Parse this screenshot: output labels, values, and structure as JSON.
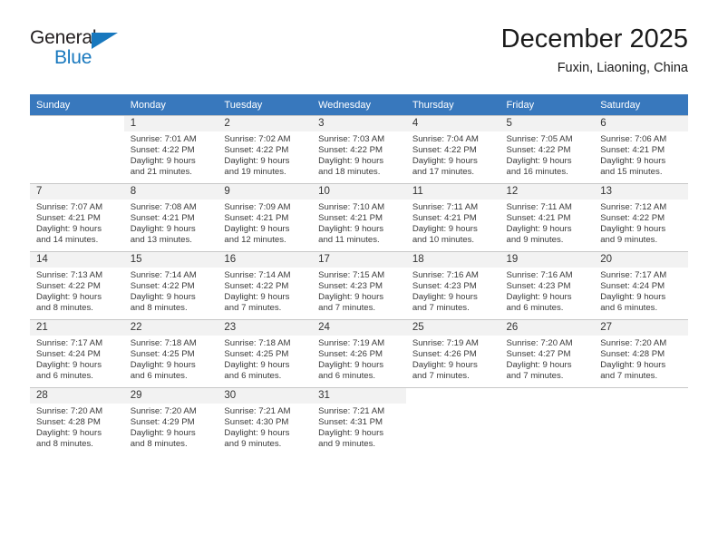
{
  "brand": {
    "name_part1": "General",
    "name_part2": "Blue",
    "triangle_color": "#1878be"
  },
  "header": {
    "title": "December 2025",
    "subtitle": "Fuxin, Liaoning, China",
    "header_bg": "#3878bd"
  },
  "weekdays": [
    "Sunday",
    "Monday",
    "Tuesday",
    "Wednesday",
    "Thursday",
    "Friday",
    "Saturday"
  ],
  "labels": {
    "sunrise_prefix": "Sunrise:",
    "sunset_prefix": "Sunset:",
    "daylight_prefix": "Daylight:"
  },
  "weeks": [
    [
      {
        "day": "",
        "empty": true
      },
      {
        "day": "1",
        "line1": "Sunrise: 7:01 AM",
        "line2": "Sunset: 4:22 PM",
        "line3": "Daylight: 9 hours",
        "line4": "and 21 minutes."
      },
      {
        "day": "2",
        "line1": "Sunrise: 7:02 AM",
        "line2": "Sunset: 4:22 PM",
        "line3": "Daylight: 9 hours",
        "line4": "and 19 minutes."
      },
      {
        "day": "3",
        "line1": "Sunrise: 7:03 AM",
        "line2": "Sunset: 4:22 PM",
        "line3": "Daylight: 9 hours",
        "line4": "and 18 minutes."
      },
      {
        "day": "4",
        "line1": "Sunrise: 7:04 AM",
        "line2": "Sunset: 4:22 PM",
        "line3": "Daylight: 9 hours",
        "line4": "and 17 minutes."
      },
      {
        "day": "5",
        "line1": "Sunrise: 7:05 AM",
        "line2": "Sunset: 4:22 PM",
        "line3": "Daylight: 9 hours",
        "line4": "and 16 minutes."
      },
      {
        "day": "6",
        "line1": "Sunrise: 7:06 AM",
        "line2": "Sunset: 4:21 PM",
        "line3": "Daylight: 9 hours",
        "line4": "and 15 minutes."
      }
    ],
    [
      {
        "day": "7",
        "line1": "Sunrise: 7:07 AM",
        "line2": "Sunset: 4:21 PM",
        "line3": "Daylight: 9 hours",
        "line4": "and 14 minutes."
      },
      {
        "day": "8",
        "line1": "Sunrise: 7:08 AM",
        "line2": "Sunset: 4:21 PM",
        "line3": "Daylight: 9 hours",
        "line4": "and 13 minutes."
      },
      {
        "day": "9",
        "line1": "Sunrise: 7:09 AM",
        "line2": "Sunset: 4:21 PM",
        "line3": "Daylight: 9 hours",
        "line4": "and 12 minutes."
      },
      {
        "day": "10",
        "line1": "Sunrise: 7:10 AM",
        "line2": "Sunset: 4:21 PM",
        "line3": "Daylight: 9 hours",
        "line4": "and 11 minutes."
      },
      {
        "day": "11",
        "line1": "Sunrise: 7:11 AM",
        "line2": "Sunset: 4:21 PM",
        "line3": "Daylight: 9 hours",
        "line4": "and 10 minutes."
      },
      {
        "day": "12",
        "line1": "Sunrise: 7:11 AM",
        "line2": "Sunset: 4:21 PM",
        "line3": "Daylight: 9 hours",
        "line4": "and 9 minutes."
      },
      {
        "day": "13",
        "line1": "Sunrise: 7:12 AM",
        "line2": "Sunset: 4:22 PM",
        "line3": "Daylight: 9 hours",
        "line4": "and 9 minutes."
      }
    ],
    [
      {
        "day": "14",
        "line1": "Sunrise: 7:13 AM",
        "line2": "Sunset: 4:22 PM",
        "line3": "Daylight: 9 hours",
        "line4": "and 8 minutes."
      },
      {
        "day": "15",
        "line1": "Sunrise: 7:14 AM",
        "line2": "Sunset: 4:22 PM",
        "line3": "Daylight: 9 hours",
        "line4": "and 8 minutes."
      },
      {
        "day": "16",
        "line1": "Sunrise: 7:14 AM",
        "line2": "Sunset: 4:22 PM",
        "line3": "Daylight: 9 hours",
        "line4": "and 7 minutes."
      },
      {
        "day": "17",
        "line1": "Sunrise: 7:15 AM",
        "line2": "Sunset: 4:23 PM",
        "line3": "Daylight: 9 hours",
        "line4": "and 7 minutes."
      },
      {
        "day": "18",
        "line1": "Sunrise: 7:16 AM",
        "line2": "Sunset: 4:23 PM",
        "line3": "Daylight: 9 hours",
        "line4": "and 7 minutes."
      },
      {
        "day": "19",
        "line1": "Sunrise: 7:16 AM",
        "line2": "Sunset: 4:23 PM",
        "line3": "Daylight: 9 hours",
        "line4": "and 6 minutes."
      },
      {
        "day": "20",
        "line1": "Sunrise: 7:17 AM",
        "line2": "Sunset: 4:24 PM",
        "line3": "Daylight: 9 hours",
        "line4": "and 6 minutes."
      }
    ],
    [
      {
        "day": "21",
        "line1": "Sunrise: 7:17 AM",
        "line2": "Sunset: 4:24 PM",
        "line3": "Daylight: 9 hours",
        "line4": "and 6 minutes."
      },
      {
        "day": "22",
        "line1": "Sunrise: 7:18 AM",
        "line2": "Sunset: 4:25 PM",
        "line3": "Daylight: 9 hours",
        "line4": "and 6 minutes."
      },
      {
        "day": "23",
        "line1": "Sunrise: 7:18 AM",
        "line2": "Sunset: 4:25 PM",
        "line3": "Daylight: 9 hours",
        "line4": "and 6 minutes."
      },
      {
        "day": "24",
        "line1": "Sunrise: 7:19 AM",
        "line2": "Sunset: 4:26 PM",
        "line3": "Daylight: 9 hours",
        "line4": "and 6 minutes."
      },
      {
        "day": "25",
        "line1": "Sunrise: 7:19 AM",
        "line2": "Sunset: 4:26 PM",
        "line3": "Daylight: 9 hours",
        "line4": "and 7 minutes."
      },
      {
        "day": "26",
        "line1": "Sunrise: 7:20 AM",
        "line2": "Sunset: 4:27 PM",
        "line3": "Daylight: 9 hours",
        "line4": "and 7 minutes."
      },
      {
        "day": "27",
        "line1": "Sunrise: 7:20 AM",
        "line2": "Sunset: 4:28 PM",
        "line3": "Daylight: 9 hours",
        "line4": "and 7 minutes."
      }
    ],
    [
      {
        "day": "28",
        "line1": "Sunrise: 7:20 AM",
        "line2": "Sunset: 4:28 PM",
        "line3": "Daylight: 9 hours",
        "line4": "and 8 minutes."
      },
      {
        "day": "29",
        "line1": "Sunrise: 7:20 AM",
        "line2": "Sunset: 4:29 PM",
        "line3": "Daylight: 9 hours",
        "line4": "and 8 minutes."
      },
      {
        "day": "30",
        "line1": "Sunrise: 7:21 AM",
        "line2": "Sunset: 4:30 PM",
        "line3": "Daylight: 9 hours",
        "line4": "and 9 minutes."
      },
      {
        "day": "31",
        "line1": "Sunrise: 7:21 AM",
        "line2": "Sunset: 4:31 PM",
        "line3": "Daylight: 9 hours",
        "line4": "and 9 minutes."
      },
      {
        "day": "",
        "empty": true
      },
      {
        "day": "",
        "empty": true
      },
      {
        "day": "",
        "empty": true
      }
    ]
  ]
}
